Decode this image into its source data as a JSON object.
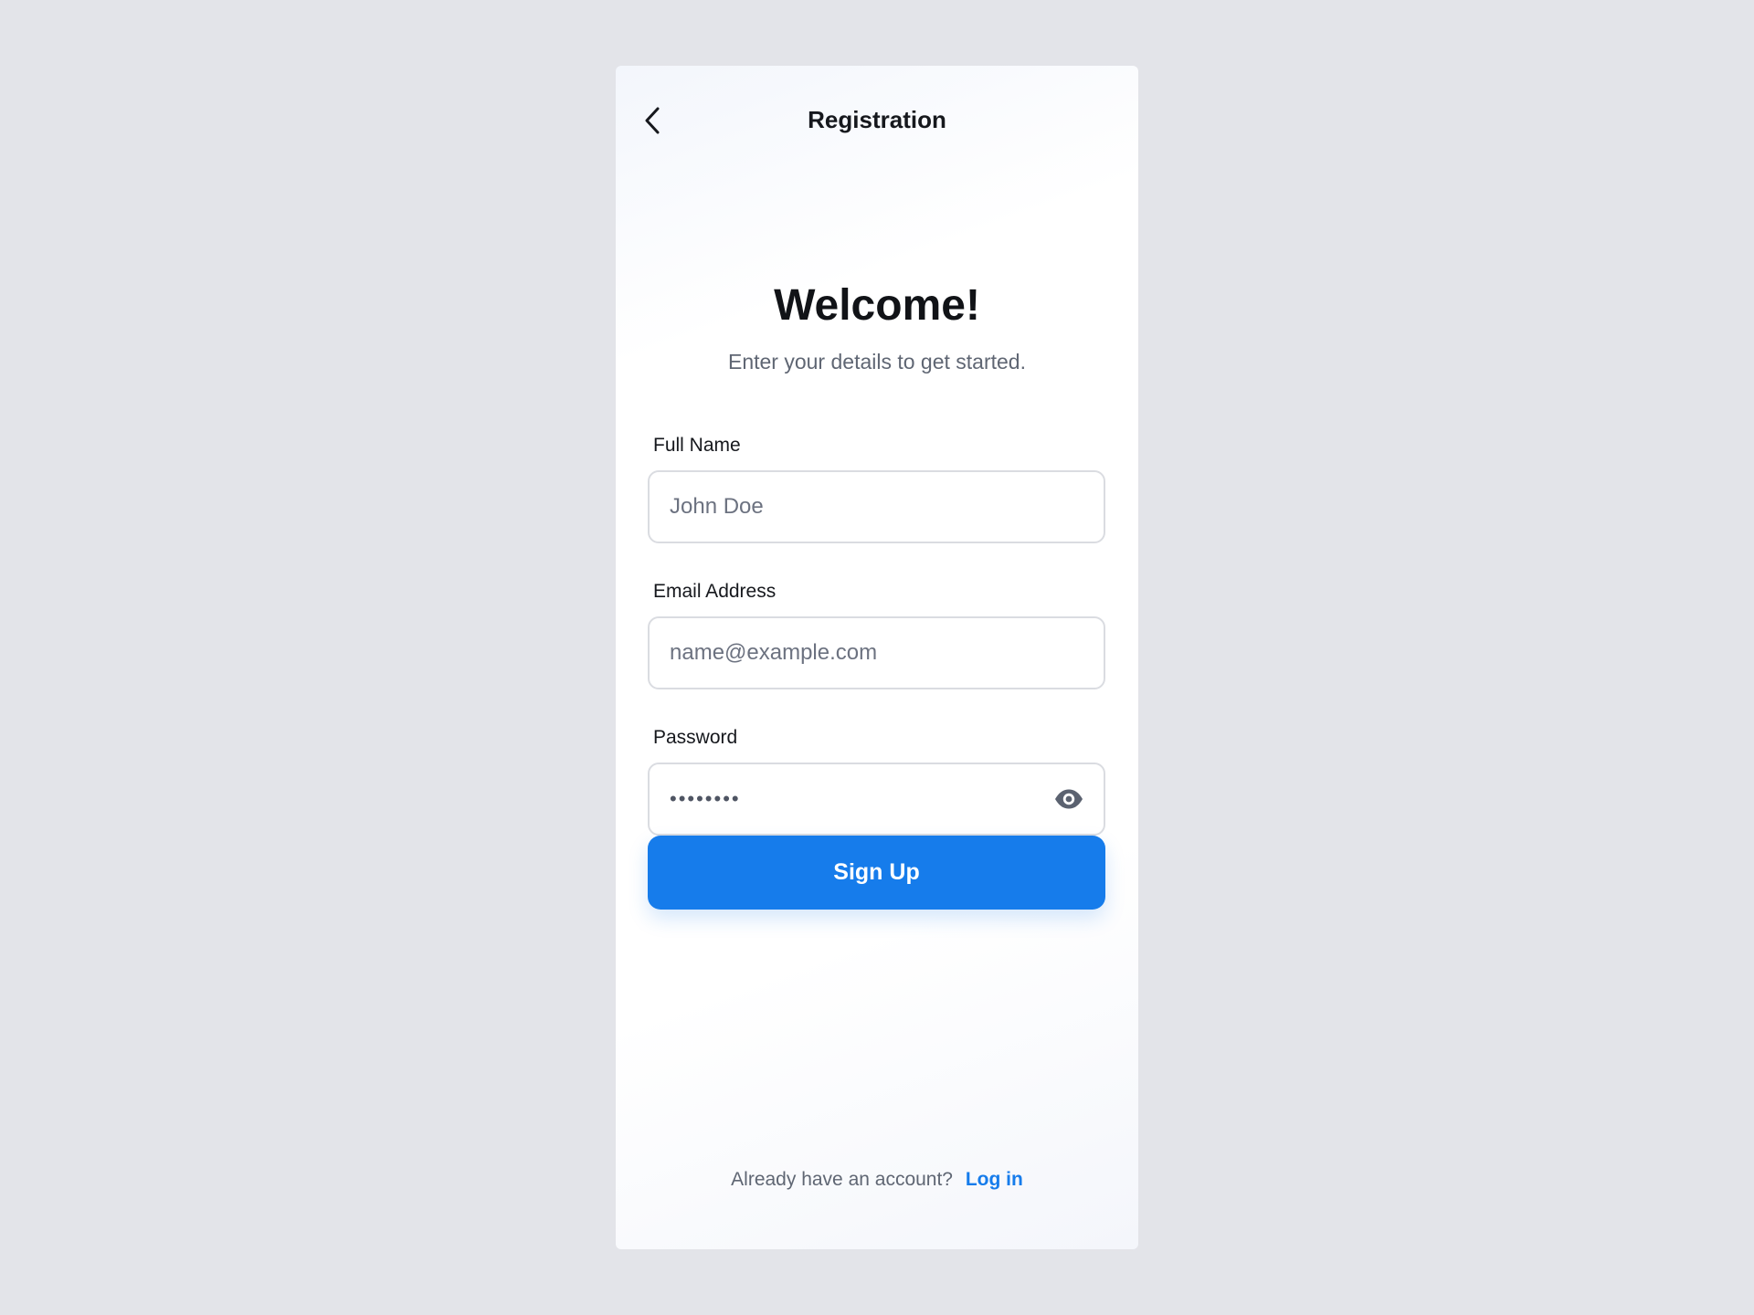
{
  "header": {
    "title": "Registration",
    "back_icon": "chevron-left-icon"
  },
  "intro": {
    "heading": "Welcome!",
    "subheading": "Enter your details to get started."
  },
  "form": {
    "full_name": {
      "label": "Full Name",
      "placeholder": "John Doe",
      "value": ""
    },
    "email": {
      "label": "Email Address",
      "placeholder": "name@example.com",
      "value": ""
    },
    "password": {
      "label": "Password",
      "masked_value": "••••••••",
      "toggle_icon": "eye-icon"
    },
    "submit_label": "Sign Up"
  },
  "footer": {
    "prompt": "Already have an account?",
    "link_label": "Log in"
  },
  "colors": {
    "background": "#e3e4e9",
    "accent": "#167ceb",
    "text_primary": "#16181d",
    "text_secondary": "#5f6673",
    "field_border": "#dadce1"
  }
}
